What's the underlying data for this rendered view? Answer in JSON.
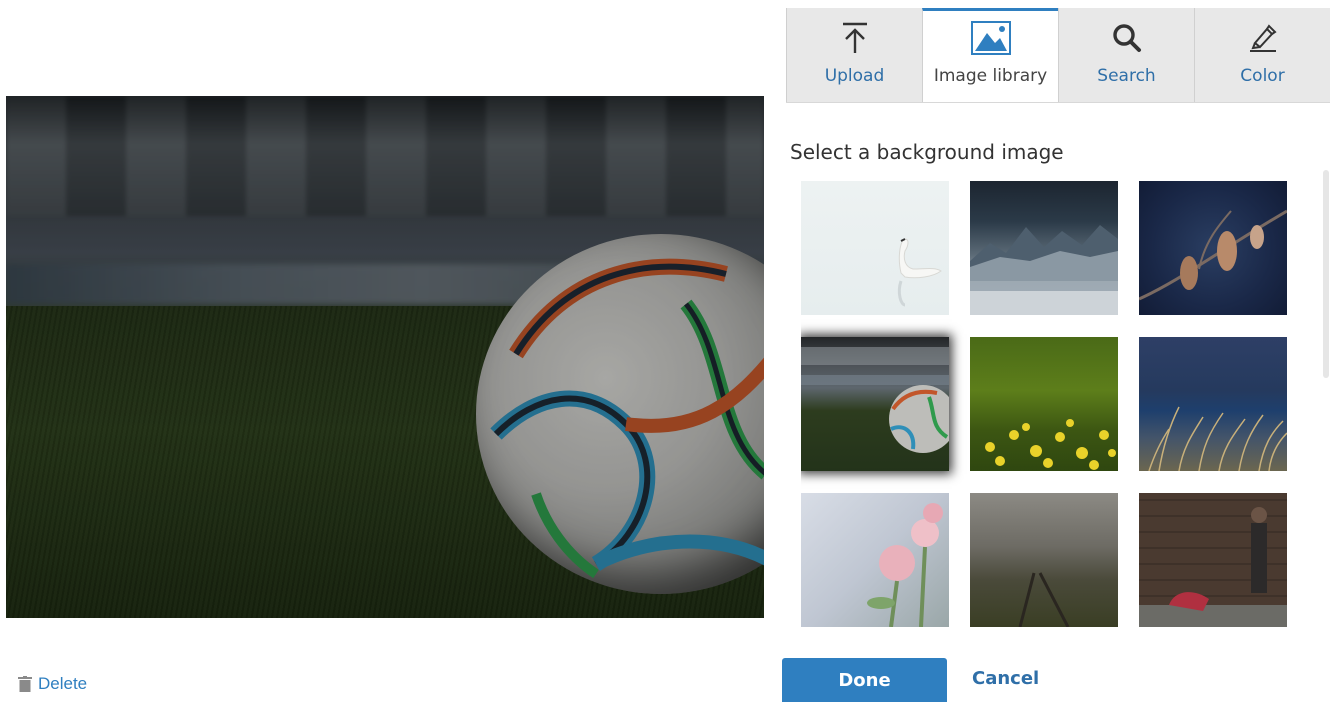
{
  "tabs": [
    {
      "label": "Upload",
      "icon": "upload-icon"
    },
    {
      "label": "Image library",
      "icon": "image-icon",
      "active": true
    },
    {
      "label": "Search",
      "icon": "search-icon"
    },
    {
      "label": "Color",
      "icon": "color-picker-icon"
    }
  ],
  "gallery": {
    "heading": "Select a background image",
    "thumbnails": [
      {
        "subject": "swan"
      },
      {
        "subject": "snowy mountains"
      },
      {
        "subject": "dried flower buds"
      },
      {
        "subject": "soccer ball on field",
        "selected": true
      },
      {
        "subject": "yellow flower meadow"
      },
      {
        "subject": "sea and grass"
      },
      {
        "subject": "pink roses"
      },
      {
        "subject": "railway track"
      },
      {
        "subject": "street musician"
      }
    ]
  },
  "actions": {
    "delete_label": "Delete",
    "done_label": "Done",
    "cancel_label": "Cancel"
  },
  "colors": {
    "accent": "#2f7fc0",
    "tab_inactive": "#e8e8e8",
    "link": "#2f6fa8"
  }
}
